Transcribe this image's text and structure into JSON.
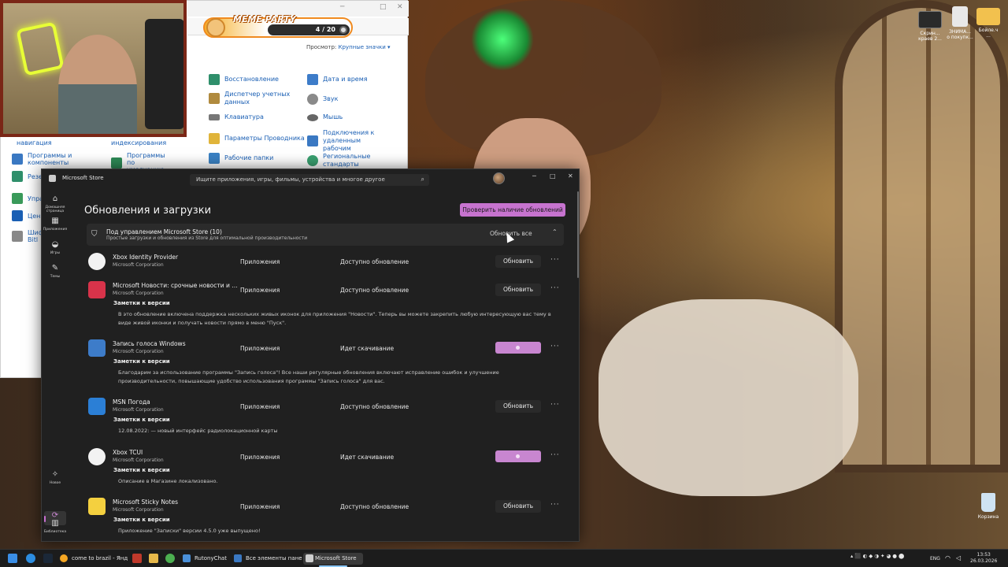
{
  "desktop": {
    "icons": [
      {
        "label": "Скрин...\nкраев 2...",
        "color": "#2a2a2a"
      },
      {
        "label": "ЗНИМА...\nо покупк...",
        "color": "#e8e8e8"
      },
      {
        "label": "Бойле.ч\n...",
        "color": "#f2c14e"
      }
    ],
    "recycle_bin": "Корзина"
  },
  "control_panel": {
    "view_label": "Просмотр:",
    "view_value": "Крупные значки ▾",
    "items": [
      {
        "label": "Восстановление",
        "color": "#2f8f6b"
      },
      {
        "label": "Дата и время",
        "color": "#3d7cc9"
      },
      {
        "label": "Диспетчер учетных данных",
        "color": "#b08a3e"
      },
      {
        "label": "Звук",
        "color": "#8a8a8a"
      },
      {
        "label": "Клавиатура",
        "color": "#777777"
      },
      {
        "label": "Мышь",
        "color": "#666666"
      },
      {
        "label": "Параметры Проводника",
        "color": "#e0b43a"
      },
      {
        "label": "Подключения к удаленным рабочим",
        "color": "#3a78c2"
      },
      {
        "label": "Рабочие папки",
        "color": "#3b82c4"
      },
      {
        "label": "Региональные стандарты",
        "color": "#3aa070"
      }
    ],
    "left_items": [
      {
        "label": "навигация"
      },
      {
        "label": "индексирования"
      },
      {
        "label": "Программы и компоненты"
      },
      {
        "label": "Программы по умолчанию"
      }
    ],
    "partial_left": [
      "Резе",
      "Упра",
      "Цен",
      "Шиф Bitl"
    ]
  },
  "meme_party": {
    "title": "MEME PARTY",
    "counter": "4 / 20"
  },
  "store": {
    "window_title": "Microsoft Store",
    "search_placeholder": "Ищите приложения, игры, фильмы, устройства и многое другое",
    "nav": [
      {
        "label": "Домашняя страница",
        "icon": "home-icon"
      },
      {
        "label": "Приложения",
        "icon": "apps-icon"
      },
      {
        "label": "Игры",
        "icon": "games-icon"
      },
      {
        "label": "Темы",
        "icon": "themes-icon"
      },
      {
        "label": "Новое",
        "icon": "new-icon"
      },
      {
        "label": "Библиотека",
        "icon": "library-icon"
      }
    ],
    "heading": "Обновления и загрузки",
    "check_updates_label": "Проверить наличие обновлений",
    "group": {
      "title": "Под управлением Microsoft Store (10)",
      "subtitle": "Простые загрузки и обновления из Store для оптимальной производительности",
      "update_all": "Обновить все"
    },
    "notes_label": "Заметки к версии",
    "apps": [
      {
        "name": "Xbox Identity Provider",
        "publisher": "Microsoft Corporation",
        "category": "Приложения",
        "status": "Доступно обновление",
        "action": "Обновить",
        "downloading": false,
        "icon_color": "#f2f2f2",
        "notes": ""
      },
      {
        "name": "Microsoft Новости: срочные новости и в...",
        "publisher": "Microsoft Corporation",
        "category": "Приложения",
        "status": "Доступно обновление",
        "action": "Обновить",
        "downloading": false,
        "icon_color": "#d8334a",
        "notes": "В это обновление включена поддержка нескольких живых иконок для приложения \"Новости\". Теперь вы можете закрепить любую интересующую вас тему в виде живой иконки и получать новости прямо в меню \"Пуск\"."
      },
      {
        "name": "Запись голоса Windows",
        "publisher": "Microsoft Corporation",
        "category": "Приложения",
        "status": "Идет скачивание",
        "action": "",
        "downloading": true,
        "icon_color": "#3d7cc9",
        "notes": "Благодарим за использование программы \"Запись голоса\"! Все наши регулярные обновления включают исправление ошибок и улучшение производительности, повышающие удобство использования программы \"Запись голоса\" для вас."
      },
      {
        "name": "MSN Погода",
        "publisher": "Microsoft Corporation",
        "category": "Приложения",
        "status": "Доступно обновление",
        "action": "Обновить",
        "downloading": false,
        "icon_color": "#2b7fd6",
        "notes": "12.08.2022: — новый интерфейс радиолокационной карты"
      },
      {
        "name": "Xbox TCUI",
        "publisher": "Microsoft Corporation",
        "category": "Приложения",
        "status": "Идет скачивание",
        "action": "",
        "downloading": true,
        "icon_color": "#f2f2f2",
        "notes": "Описание в Магазине локализовано."
      },
      {
        "name": "Microsoft Sticky Notes",
        "publisher": "Microsoft Corporation",
        "category": "Приложения",
        "status": "Доступно обновление",
        "action": "Обновить",
        "downloading": false,
        "icon_color": "#f4d03f",
        "notes": "Приложение \"Записки\" версии 4.5.0 уже выпущено!"
      }
    ]
  },
  "taskbar": {
    "apps": [
      {
        "label": "come to brazil - Янд",
        "color": "#f5a623"
      },
      {
        "label": "RutonyChat",
        "color": "#4a90d9"
      },
      {
        "label": "Все элементы пане",
        "color": "#3a78c2"
      },
      {
        "label": "Microsoft Store",
        "color": "#cfcfcf"
      }
    ],
    "lang": "ENG",
    "time": "13:53",
    "date": "26.03.2026"
  }
}
